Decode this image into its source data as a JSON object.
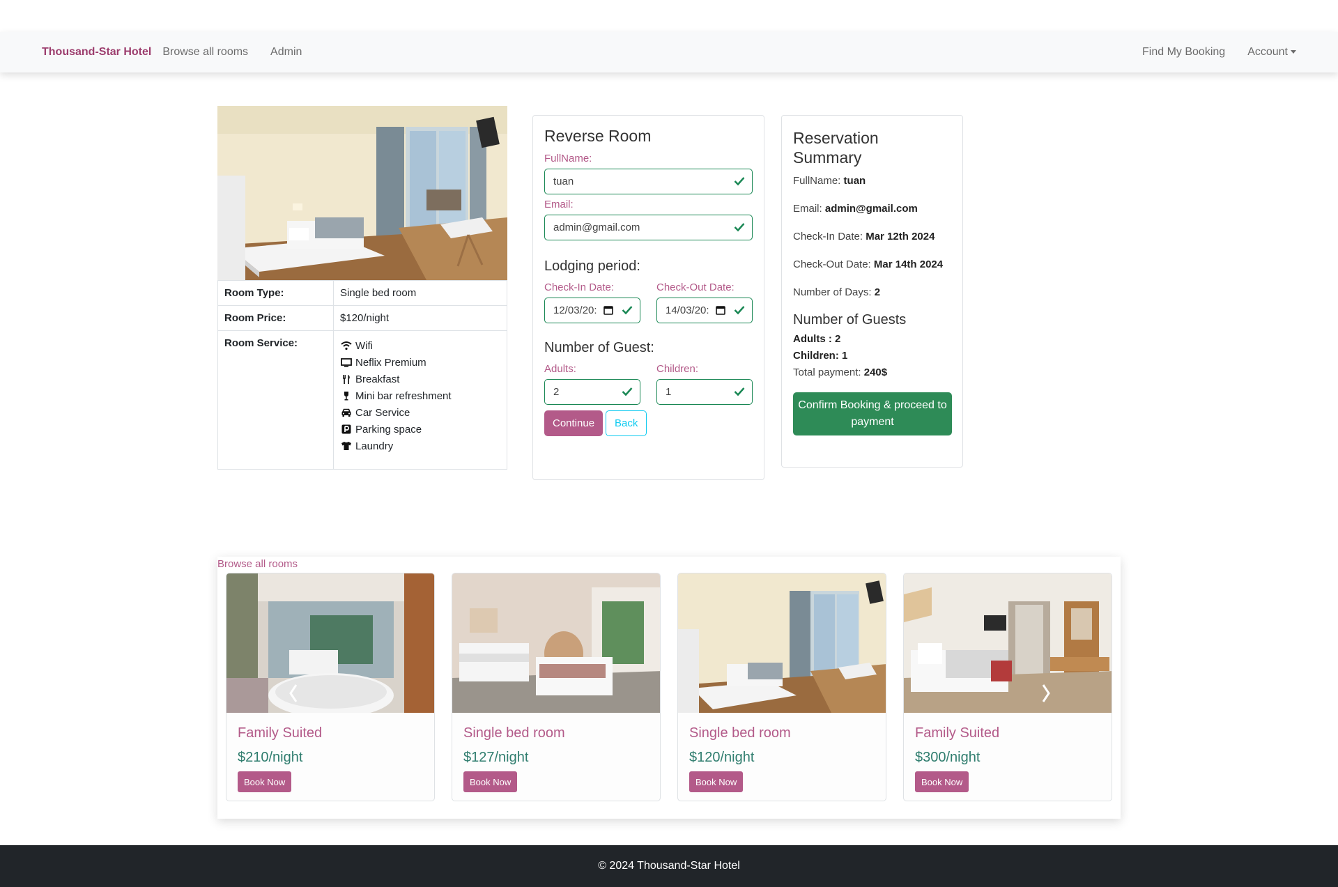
{
  "navbar": {
    "brand": "Thousand-Star Hotel",
    "browse_rooms": "Browse all rooms",
    "admin": "Admin",
    "find_booking": "Find My Booking",
    "account": "Account"
  },
  "room": {
    "type_label": "Room Type:",
    "type_value": "Single bed room",
    "price_label": "Room Price:",
    "price_value": "$120/night",
    "service_label": "Room Service:",
    "services": [
      {
        "label": "Wifi",
        "icon": "wifi-icon"
      },
      {
        "label": "Neflix Premium",
        "icon": "tv-icon"
      },
      {
        "label": "Breakfast",
        "icon": "utensils-icon"
      },
      {
        "label": "Mini bar refreshment",
        "icon": "wine-glass-icon"
      },
      {
        "label": "Car Service",
        "icon": "car-icon"
      },
      {
        "label": "Parking space",
        "icon": "parking-icon"
      },
      {
        "label": "Laundry",
        "icon": "tshirt-icon"
      }
    ]
  },
  "form": {
    "title": "Reverse Room",
    "fullname_label": "FullName:",
    "fullname_value": "tuan",
    "email_label": "Email:",
    "email_value": "admin@gmail.com",
    "lodging_title": "Lodging period:",
    "checkin_label": "Check-In Date:",
    "checkin_value": "12/03/20:",
    "checkout_label": "Check-Out Date:",
    "checkout_value": "14/03/20:",
    "guests_title": "Number of Guest:",
    "adults_label": "Adults:",
    "adults_value": "2",
    "children_label": "Children:",
    "children_value": "1",
    "continue_label": "Continue",
    "back_label": "Back"
  },
  "summary": {
    "title": "Reservation Summary",
    "fullname_label": "FullName:",
    "fullname_value": "tuan",
    "email_label": "Email:",
    "email_value": "admin@gmail.com",
    "checkin_label": "Check-In Date:",
    "checkin_value": "Mar 12th 2024",
    "checkout_label": "Check-Out Date:",
    "checkout_value": "Mar 14th 2024",
    "days_label": "Number of Days:",
    "days_value": "2",
    "guests_title": "Number of Guests",
    "adults_text": "Adults : 2",
    "children_text": "Children: 1",
    "total_label": "Total payment:",
    "total_value": "240$",
    "confirm_label": "Confirm Booking & proceed to payment"
  },
  "browse": {
    "title": "Browse all rooms",
    "book_label": "Book Now",
    "rooms": [
      {
        "name": "Family Suited",
        "price": "$210/night"
      },
      {
        "name": "Single bed room",
        "price": "$127/night"
      },
      {
        "name": "Single bed room",
        "price": "$120/night"
      },
      {
        "name": "Family Suited",
        "price": "$300/night"
      }
    ]
  },
  "footer": {
    "text": "© 2024 Thousand-Star Hotel"
  },
  "colors": {
    "brand": "#9c3d6d",
    "accent": "#b35a89",
    "success": "#198754",
    "confirm": "#2e8b57",
    "footer_bg": "#212529"
  }
}
